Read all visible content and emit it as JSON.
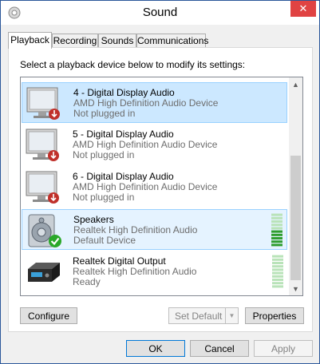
{
  "window": {
    "title": "Sound",
    "close_glyph": "✕"
  },
  "tabs": [
    {
      "label": "Playback",
      "active": true
    },
    {
      "label": "Recording",
      "active": false
    },
    {
      "label": "Sounds",
      "active": false
    },
    {
      "label": "Communications",
      "active": false
    }
  ],
  "playback": {
    "instruction": "Select a playback device below to modify its settings:",
    "devices": [
      {
        "name": "4 - Digital Display Audio",
        "driver": "AMD High Definition Audio Device",
        "status": "Not plugged in",
        "icon": "monitor-icon",
        "badge": "unplugged-badge-icon",
        "state": "selected"
      },
      {
        "name": "5 - Digital Display Audio",
        "driver": "AMD High Definition Audio Device",
        "status": "Not plugged in",
        "icon": "monitor-icon",
        "badge": "unplugged-badge-icon",
        "state": "normal"
      },
      {
        "name": "6 - Digital Display Audio",
        "driver": "AMD High Definition Audio Device",
        "status": "Not plugged in",
        "icon": "monitor-icon",
        "badge": "unplugged-badge-icon",
        "state": "normal"
      },
      {
        "name": "Speakers",
        "driver": "Realtek High Definition Audio",
        "status": "Default Device",
        "icon": "speaker-icon",
        "badge": "default-check-icon",
        "state": "hover",
        "level": 0.5
      },
      {
        "name": "Realtek Digital Output",
        "driver": "Realtek High Definition Audio",
        "status": "Ready",
        "icon": "digital-output-icon",
        "badge": "",
        "state": "normal",
        "level": 0
      }
    ]
  },
  "buttons": {
    "configure": "Configure",
    "set_default": "Set Default",
    "properties": "Properties",
    "ok": "OK",
    "cancel": "Cancel",
    "apply": "Apply"
  },
  "scrollbar": {
    "up_glyph": "▲",
    "down_glyph": "▼"
  },
  "colors": {
    "selection": "#cce8ff",
    "close_button": "#e04343",
    "default_check": "#2aa82a",
    "unplugged_badge": "#c0302a",
    "level_on": "#2f9e2f",
    "level_off": "#b9e3b9"
  }
}
